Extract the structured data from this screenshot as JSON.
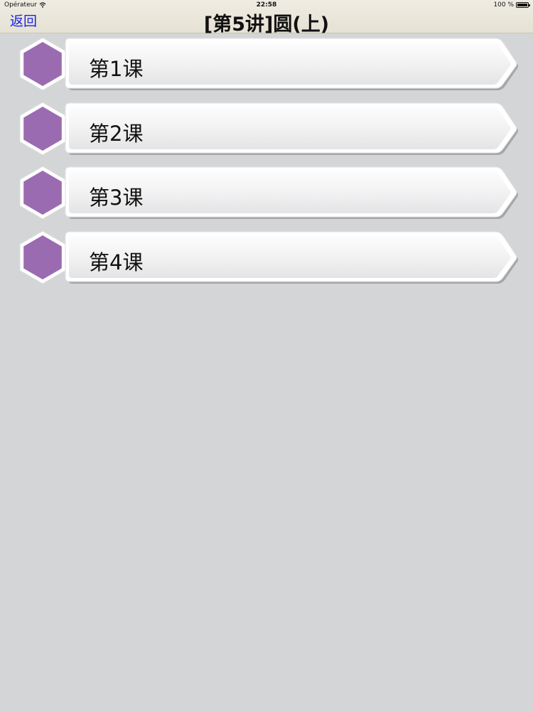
{
  "status_bar": {
    "carrier": "Opérateur",
    "time": "22:58",
    "battery_text": "100 %",
    "battery_level": 1.0
  },
  "nav": {
    "back_label": "返回",
    "title": "[第5讲]圆(上)"
  },
  "lessons": [
    {
      "label": "第1课"
    },
    {
      "label": "第2课"
    },
    {
      "label": "第3课"
    },
    {
      "label": "第4课"
    }
  ],
  "colors": {
    "background": "#d4d5d6",
    "accent_hexagon": "#9b6bb2",
    "back_link": "#1a22e6"
  },
  "icons": {
    "lesson_icon": "purple-hexagon-icon",
    "wifi": "wifi-icon",
    "battery": "battery-icon"
  }
}
